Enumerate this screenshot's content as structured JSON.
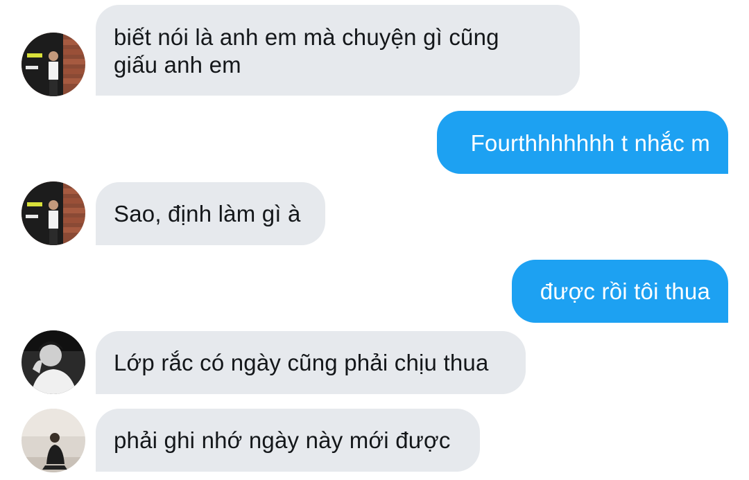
{
  "messages": [
    {
      "side": "in",
      "avatar": "avatar-1",
      "lines": [
        "biết nói là anh em mà chuyện gì cũng",
        "giấu anh em"
      ]
    },
    {
      "side": "out",
      "lines": [
        "Fourthhhhhhh t nhắc m"
      ]
    },
    {
      "side": "in",
      "avatar": "avatar-1",
      "lines": [
        "Sao, định làm gì à"
      ]
    },
    {
      "side": "out",
      "lines": [
        "được rồi tôi thua"
      ]
    },
    {
      "side": "in",
      "avatar": "avatar-2",
      "lines": [
        "Lớp rắc có ngày cũng phải chịu thua"
      ]
    },
    {
      "side": "in",
      "avatar": "avatar-3",
      "lines": [
        "phải ghi nhớ ngày này mới được"
      ]
    }
  ],
  "colors": {
    "incoming_bubble": "#e6e9ed",
    "outgoing_bubble": "#1da1f2",
    "incoming_text": "#14171a",
    "outgoing_text": "#ffffff"
  }
}
